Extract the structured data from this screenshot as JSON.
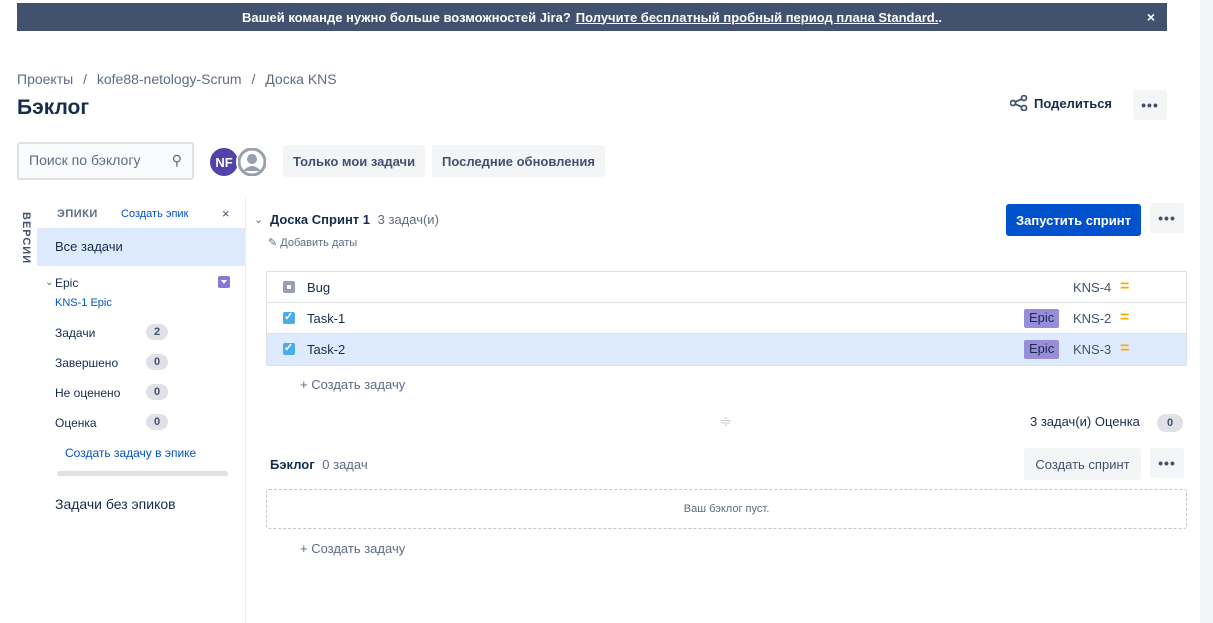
{
  "banner": {
    "text": "Вашей команде нужно больше возможностей Jira?",
    "link": "Получите бесплатный пробный период плана Standard.",
    "suffix": ".",
    "close": "×"
  },
  "breadcrumb": [
    "Проекты",
    "kofe88-netology-Scrum",
    "Доска KNS"
  ],
  "breadcrumb_sep": "/",
  "page_title": "Бэклог",
  "share_label": "Поделиться",
  "more_label": "•••",
  "search": {
    "placeholder": "Поиск по бэклогу"
  },
  "avatars": {
    "user_initials": "NF"
  },
  "filters": [
    "Только мои задачи",
    "Последние обновления"
  ],
  "versions_label": "ВЕРСИИ",
  "epics": {
    "header": "ЭПИКИ",
    "create_label": "Создать эпик",
    "close": "×",
    "all_tasks": "Все задачи",
    "epic_name": "Epic",
    "epic_key": "KNS-1 Epic",
    "stats": [
      {
        "label": "Задачи",
        "value": "2"
      },
      {
        "label": "Завершено",
        "value": "0"
      },
      {
        "label": "Не оценено",
        "value": "0"
      },
      {
        "label": "Оценка",
        "value": "0"
      }
    ],
    "create_in_epic": "Создать задачу в эпике",
    "no_epic": "Задачи без эпиков"
  },
  "sprint": {
    "name": "Доска Спринт 1",
    "count": "3 задач(и)",
    "add_dates": "Добавить даты",
    "start_label": "Запустить спринт",
    "issues": [
      {
        "type": "bug",
        "name": "Bug",
        "epic": "",
        "key": "KNS-4",
        "priority": "="
      },
      {
        "type": "task",
        "name": "Task-1",
        "epic": "Epic",
        "key": "KNS-2",
        "priority": "="
      },
      {
        "type": "task",
        "name": "Task-2",
        "epic": "Epic",
        "key": "KNS-3",
        "priority": "="
      }
    ],
    "create_task": "+ Создать задачу",
    "summary": "3 задач(и) Оценка",
    "estimate": "0"
  },
  "backlog": {
    "name": "Бэклог",
    "count": "0 задач",
    "create_sprint": "Создать спринт",
    "empty": "Ваш бэклог пуст.",
    "create_task": "+ Создать задачу"
  },
  "colors": {
    "primary": "#0052cc",
    "banner": "#42526e",
    "selected": "#deebff",
    "epic": "#998dd9",
    "priority_medium": "#ffab00"
  }
}
